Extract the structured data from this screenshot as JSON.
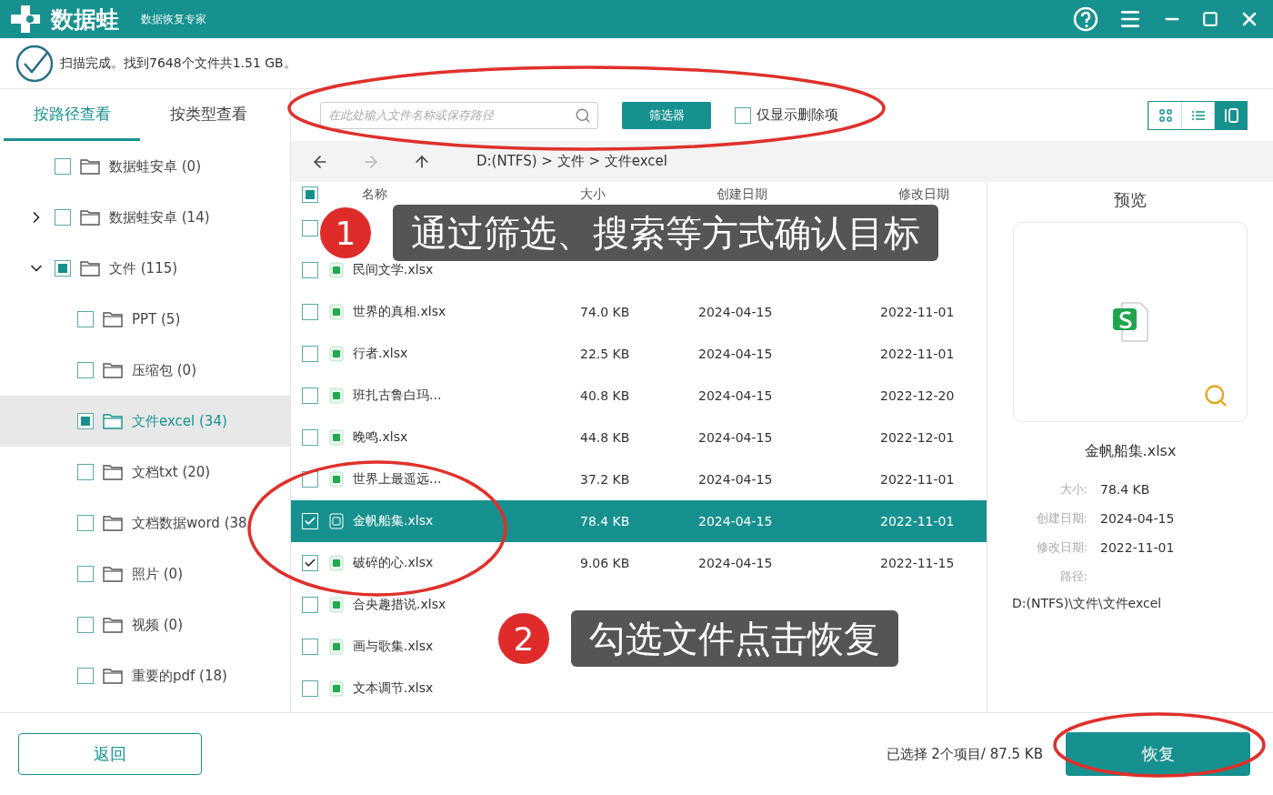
{
  "app": {
    "name": "数据蛙",
    "subtitle": "数据恢复专家"
  },
  "scan_status": "扫描完成。找到7648个文件共1.51 GB。",
  "view_tabs": [
    {
      "label": "按路径查看",
      "selected": true
    },
    {
      "label": "按类型查看",
      "selected": false
    }
  ],
  "tree": [
    {
      "label": "数据蛙安卓 (0)",
      "checked": false,
      "indeterminate": false,
      "selected": false
    },
    {
      "label": "数据蛙安卓 (14)",
      "checked": false,
      "indeterminate": false,
      "selected": false,
      "expanded": false
    },
    {
      "label": "文件 (115)",
      "checked": false,
      "indeterminate": true,
      "selected": false,
      "expanded": true,
      "children": [
        {
          "label": "PPT (5)",
          "checked": false,
          "indeterminate": false,
          "selected": false
        },
        {
          "label": "压缩包 (0)",
          "checked": false,
          "indeterminate": false,
          "selected": false
        },
        {
          "label": "文件excel (34)",
          "checked": false,
          "indeterminate": true,
          "selected": true
        },
        {
          "label": "文档txt (20)",
          "checked": false,
          "indeterminate": false,
          "selected": false
        },
        {
          "label": "文档数据word (38",
          "checked": false,
          "indeterminate": false,
          "selected": false
        },
        {
          "label": "照片 (0)",
          "checked": false,
          "indeterminate": false,
          "selected": false
        },
        {
          "label": "视频 (0)",
          "checked": false,
          "indeterminate": false,
          "selected": false
        },
        {
          "label": "重要的pdf (18)",
          "checked": false,
          "indeterminate": false,
          "selected": false
        }
      ]
    }
  ],
  "search": {
    "placeholder": "在此处输入文件名称或保存路径"
  },
  "filter_button": "筛选器",
  "deleted_only": {
    "label": "仅显示删除项",
    "checked": false
  },
  "view_modes": [
    {
      "kind": "grid",
      "selected": false
    },
    {
      "kind": "list",
      "selected": false
    },
    {
      "kind": "preview",
      "selected": true
    }
  ],
  "breadcrumb": "D:(NTFS) > 文件 > 文件excel",
  "table": {
    "select_all": {
      "checked": false,
      "indeterminate": true
    },
    "columns": [
      "名称",
      "大小",
      "创建日期",
      "修改日期"
    ],
    "rows": [
      {
        "checked": false,
        "selected": false
      },
      {
        "name": "民间文学.xlsx",
        "checked": false,
        "selected": false
      },
      {
        "name": "世界的真相.xlsx",
        "size": "74.0 KB",
        "created": "2024-04-15",
        "modified": "2022-11-01",
        "checked": false,
        "selected": false
      },
      {
        "name": "行者.xlsx",
        "size": "22.5 KB",
        "created": "2024-04-15",
        "modified": "2022-11-01",
        "checked": false,
        "selected": false
      },
      {
        "name": "班扎古鲁白玛...",
        "size": "40.8 KB",
        "created": "2024-04-15",
        "modified": "2022-12-20",
        "checked": false,
        "selected": false
      },
      {
        "name": "晚鸣.xlsx",
        "size": "44.8 KB",
        "created": "2024-04-15",
        "modified": "2022-12-01",
        "checked": false,
        "selected": false
      },
      {
        "name": "世界上最遥远...",
        "size": "37.2 KB",
        "created": "2024-04-15",
        "modified": "2022-11-01",
        "checked": false,
        "selected": false
      },
      {
        "name": "金帆船集.xlsx",
        "size": "78.4 KB",
        "created": "2024-04-15",
        "modified": "2022-11-01",
        "checked": true,
        "selected": true
      },
      {
        "name": "破碎的心.xlsx",
        "size": "9.06 KB",
        "created": "2024-04-15",
        "modified": "2022-11-15",
        "checked": true,
        "selected": false
      },
      {
        "name": "合央趣措说.xlsx",
        "checked": false,
        "selected": false
      },
      {
        "name": "画与歌集.xlsx",
        "checked": false,
        "selected": false
      },
      {
        "name": "文本调节.xlsx",
        "checked": false,
        "selected": false
      }
    ]
  },
  "preview": {
    "title": "预览",
    "file_name": "金帆船集.xlsx",
    "details": [
      {
        "label": "大小:",
        "value": "78.4 KB"
      },
      {
        "label": "创建日期:",
        "value": "2024-04-15"
      },
      {
        "label": "修改日期:",
        "value": "2022-11-01"
      }
    ],
    "path_label": "路径:",
    "path": "D:(NTFS)\\文件\\文件excel"
  },
  "back_button": "返回",
  "selection_summary": "已选择 2个项目/ 87.5 KB",
  "recover_button": "恢复",
  "callouts": [
    {
      "number": "1",
      "text": "通过筛选、搜索等方式确认目标"
    },
    {
      "number": "2",
      "text": "勾选文件点击恢复"
    }
  ]
}
